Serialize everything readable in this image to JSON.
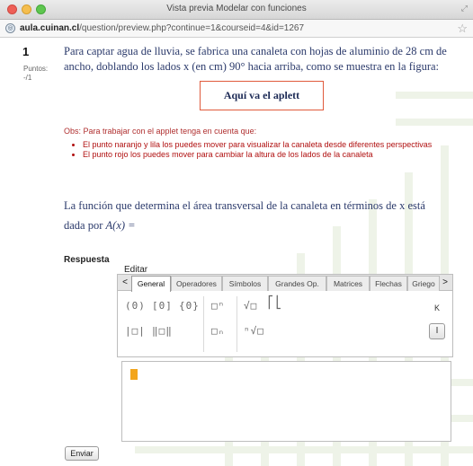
{
  "window": {
    "title": "Vista previa Modelar con funciones",
    "url_domain": "aula.cuinan.cl",
    "url_path": "/question/preview.php?continue=1&courseid=4&id=1267"
  },
  "question": {
    "number": "1",
    "points_label": "Puntos:",
    "points_value": "-/1",
    "text": "Para captar agua de lluvia, se fabrica una canaleta con hojas de aluminio de 28 cm de ancho, doblando los lados x (en cm) 90° hacia arriba, como se muestra en la figura:",
    "applet_placeholder": "Aquí va el aplett",
    "obs_title": "Obs: Para trabajar con el applet tenga en cuenta que:",
    "obs_items": [
      "El punto naranjo y lila los puedes mover para visualizar la canaleta desde diferentes perspectivas",
      "El punto rojo los puedes mover para cambiar la altura de los lados de la canaleta"
    ],
    "function_text": "La función que determina el área transversal de la canaleta en términos de x está dada por",
    "function_symbol": "A(x) ="
  },
  "answer": {
    "label": "Respuesta",
    "editor_label": "Editar",
    "tabs": [
      "General",
      "Operadores",
      "Símbolos",
      "Grandes Op.",
      "Matrices",
      "Flechas",
      "Griego"
    ],
    "active_tab": "General",
    "tab_prev": "<",
    "tab_next": ">",
    "symbols_row1": [
      "(0)",
      "[0]",
      "{0}",
      "□ⁿ",
      "√□",
      "⎡⎣"
    ],
    "symbols_row2": [
      "|□|",
      "‖□‖",
      "□ₙ",
      "ⁿ√□"
    ],
    "side_key_label": "K",
    "side_button_label": "I",
    "submit_label": "Enviar"
  },
  "colors": {
    "question_text": "#2b3a6b",
    "obs_text": "#b01010",
    "applet_border": "#e05a3c",
    "cursor": "#f3a51b"
  }
}
